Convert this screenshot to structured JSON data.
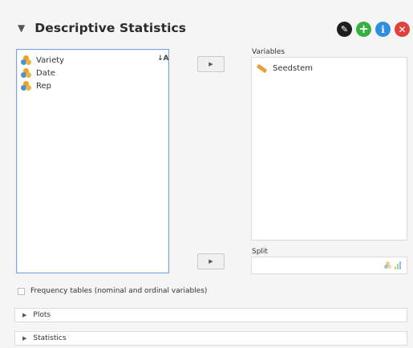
{
  "analysis": {
    "title": "Descriptive Statistics",
    "collapse_glyph": "▼"
  },
  "header_buttons": [
    {
      "name": "edit-icon",
      "glyph": "✎",
      "color": "#1e1e1e"
    },
    {
      "name": "add-icon",
      "glyph": "+",
      "color": "#36b13f"
    },
    {
      "name": "info-icon",
      "glyph": "i",
      "color": "#2e8fe0"
    },
    {
      "name": "close-icon",
      "glyph": "✕",
      "color": "#e0413b"
    }
  ],
  "source_list": {
    "items": [
      {
        "label": "Variety",
        "icon": "nominal-icon"
      },
      {
        "label": "Date",
        "icon": "nominal-icon"
      },
      {
        "label": "Rep",
        "icon": "nominal-icon"
      }
    ],
    "sort_glyph": "↓A"
  },
  "assign_button_glyph": "▶",
  "variables": {
    "label": "Variables",
    "items": [
      {
        "label": "Seedstem",
        "icon": "scale-ruler-icon"
      }
    ]
  },
  "split": {
    "label": "Split",
    "items": []
  },
  "frequency_tables": {
    "label": "Frequency tables (nominal and ordinal variables)",
    "checked": false
  },
  "sections": {
    "plots": {
      "label": "Plots",
      "glyph": "▶"
    },
    "statistics": {
      "label": "Statistics",
      "glyph": "▶"
    }
  },
  "colors": {
    "accent_blue": "#2e8fe0",
    "add_green": "#36b13f",
    "close_red": "#e0413b",
    "list_border": "#7aa7dd"
  }
}
